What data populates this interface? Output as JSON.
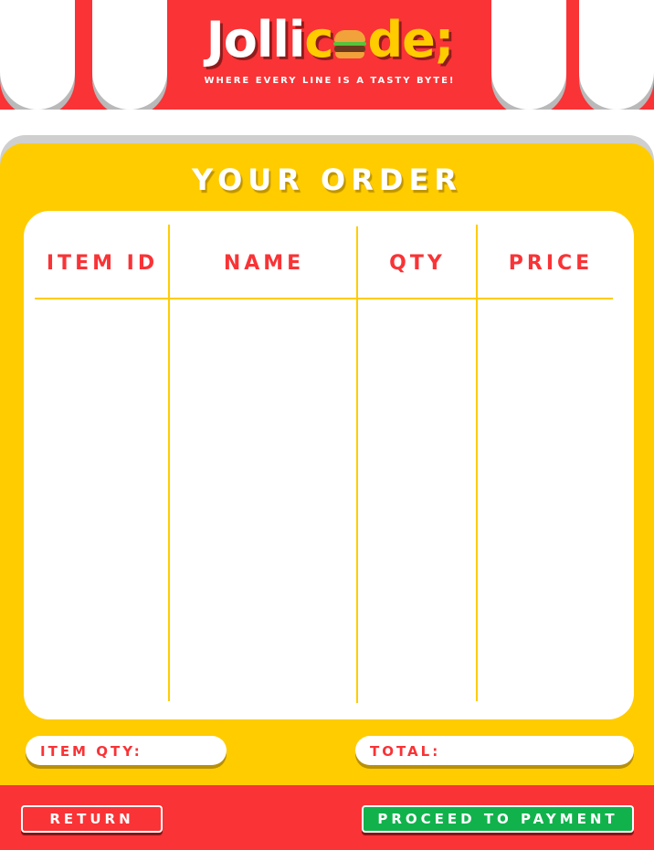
{
  "header": {
    "logo_part1": "Jolli",
    "logo_part2": "c",
    "logo_part3": "de;",
    "logo_icon": "burger-icon",
    "tagline": "WHERE EVERY LINE IS A TASTY BYTE!"
  },
  "order": {
    "title": "YOUR ORDER",
    "columns": [
      "ITEM ID",
      "NAME",
      "QTY",
      "PRICE"
    ],
    "rows": []
  },
  "summary": {
    "item_qty_label": "ITEM QTY:",
    "item_qty_value": "",
    "total_label": "TOTAL:",
    "total_value": ""
  },
  "footer": {
    "return_label": "RETURN",
    "proceed_label": "PROCEED TO PAYMENT"
  },
  "colors": {
    "brand_red": "#f93336",
    "brand_yellow": "#ffcc00",
    "proceed_green": "#11b24c",
    "white": "#ffffff"
  }
}
